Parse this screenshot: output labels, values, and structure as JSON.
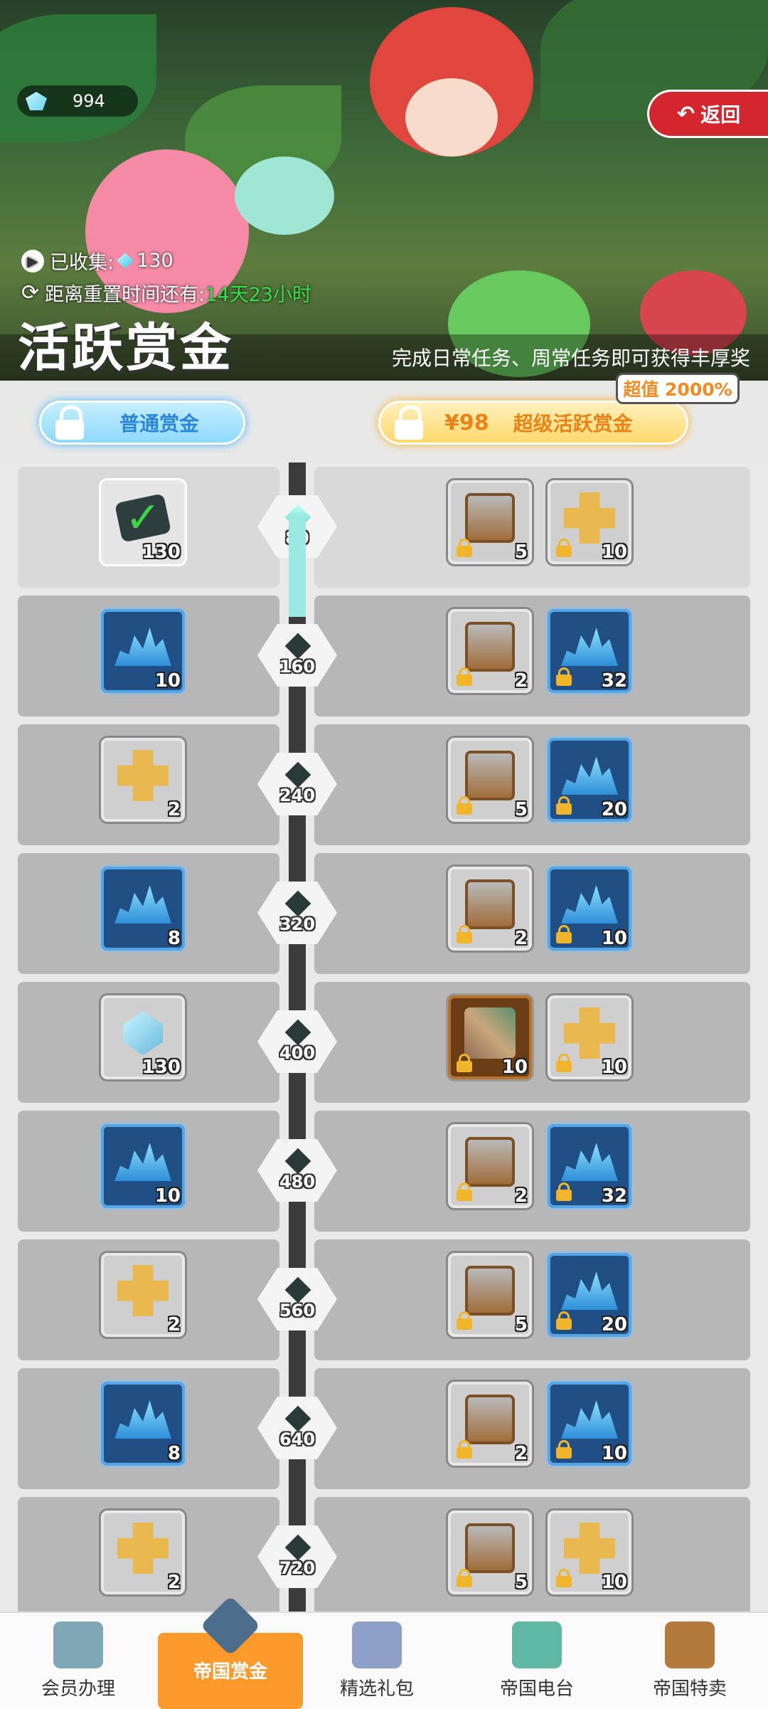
{
  "header": {
    "gem_count": "994",
    "back_label": "返回",
    "collected_label": "已收集:",
    "collected_value": "130",
    "reset_label": "距离重置时间还有:",
    "reset_time": "14天23小时",
    "title": "活跃赏金",
    "subtitle": "完成日常任务、周常任务即可获得丰厚奖"
  },
  "tabs": {
    "normal_label": "普通赏金",
    "super_price": "¥98",
    "super_label": "超级活跃赏金",
    "badge": "超值 2000%"
  },
  "rows": [
    {
      "level": "80",
      "free": {
        "icon": "ticket-check-icon",
        "qty": "130",
        "style": "white"
      },
      "paid": [
        {
          "icon": "chest-icon",
          "qty": "5"
        },
        {
          "icon": "blocks-icon",
          "qty": "10"
        }
      ]
    },
    {
      "level": "160",
      "free": {
        "icon": "crystals-icon",
        "qty": "10",
        "style": "blue"
      },
      "paid": [
        {
          "icon": "chest-icon",
          "qty": "2"
        },
        {
          "icon": "crystals-icon",
          "qty": "32"
        }
      ]
    },
    {
      "level": "240",
      "free": {
        "icon": "blocks-icon",
        "qty": "2",
        "style": "grey"
      },
      "paid": [
        {
          "icon": "chest-icon",
          "qty": "5"
        },
        {
          "icon": "crystals-icon",
          "qty": "20"
        }
      ]
    },
    {
      "level": "320",
      "free": {
        "icon": "crystals-icon",
        "qty": "8",
        "style": "blue"
      },
      "paid": [
        {
          "icon": "chest-icon",
          "qty": "2"
        },
        {
          "icon": "crystals-icon",
          "qty": "10"
        }
      ]
    },
    {
      "level": "400",
      "free": {
        "icon": "gem-icon",
        "qty": "130",
        "style": "grey"
      },
      "paid": [
        {
          "icon": "weapon-icon",
          "qty": "10"
        },
        {
          "icon": "blocks-icon",
          "qty": "10"
        }
      ]
    },
    {
      "level": "480",
      "free": {
        "icon": "crystals-icon",
        "qty": "10",
        "style": "blue"
      },
      "paid": [
        {
          "icon": "chest-icon",
          "qty": "2"
        },
        {
          "icon": "crystals-icon",
          "qty": "32"
        }
      ]
    },
    {
      "level": "560",
      "free": {
        "icon": "blocks-icon",
        "qty": "2",
        "style": "grey"
      },
      "paid": [
        {
          "icon": "chest-icon",
          "qty": "5"
        },
        {
          "icon": "crystals-icon",
          "qty": "20"
        }
      ]
    },
    {
      "level": "640",
      "free": {
        "icon": "crystals-icon",
        "qty": "8",
        "style": "blue"
      },
      "paid": [
        {
          "icon": "chest-icon",
          "qty": "2"
        },
        {
          "icon": "crystals-icon",
          "qty": "10"
        }
      ]
    },
    {
      "level": "720",
      "free": {
        "icon": "blocks-icon",
        "qty": "2",
        "style": "grey"
      },
      "paid": [
        {
          "icon": "chest-icon",
          "qty": "5"
        },
        {
          "icon": "blocks-icon",
          "qty": "10"
        }
      ]
    }
  ],
  "progress_fraction_of_first_row": 0.8,
  "nav": [
    {
      "label": "会员办理",
      "icon": "membership-card-icon",
      "active": false
    },
    {
      "label": "帝国赏金",
      "icon": "bounty-emblem-icon",
      "active": true
    },
    {
      "label": "精选礼包",
      "icon": "gift-pack-icon",
      "active": false
    },
    {
      "label": "帝国电台",
      "icon": "radio-scroll-icon",
      "active": false
    },
    {
      "label": "帝国特卖",
      "icon": "treasure-chest-icon",
      "active": false
    }
  ],
  "colors": {
    "accent_orange": "#fb9a2a",
    "timer_green": "#36e04a",
    "back_red": "#d3262e",
    "progress_teal": "#9ae9e2"
  }
}
